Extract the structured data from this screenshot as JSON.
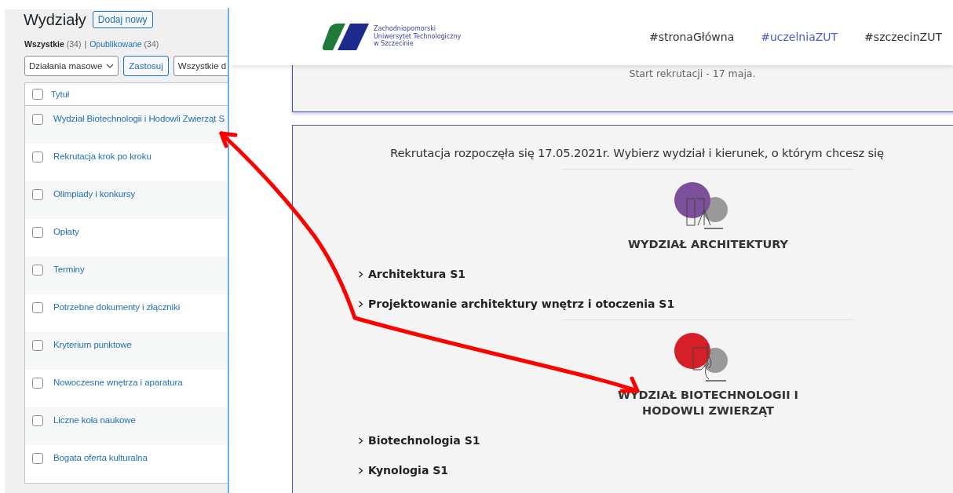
{
  "admin": {
    "title": "Wydziały",
    "add_button": "Dodaj nowy",
    "filters": [
      {
        "label": "Wszystkie",
        "count": "(34)",
        "selected": true
      },
      {
        "label": "Opublikowane",
        "count": "(34)",
        "selected": false
      }
    ],
    "filter_separator": "|",
    "bulk_actions": "Działania masowe",
    "apply_button": "Zastosuj",
    "date_filter": "Wszystkie d",
    "table": {
      "column": "Tytuł",
      "header_checked": false,
      "rows": [
        {
          "title": "Wydział Biotechnologii i Hodowli Zwierząt S",
          "checked": false
        },
        {
          "title": "Rekrutacja krok po kroku",
          "checked": false
        },
        {
          "title": "Olimpiady i konkursy",
          "checked": false
        },
        {
          "title": "Opłaty",
          "checked": false
        },
        {
          "title": "Terminy",
          "checked": false
        },
        {
          "title": "Potrzebne dokumenty i złączniki",
          "checked": false
        },
        {
          "title": "Kryterium punktowe",
          "checked": false
        },
        {
          "title": "Nowoczesne wnętrza i aparatura",
          "checked": false
        },
        {
          "title": "Liczne koła naukowe",
          "checked": false
        },
        {
          "title": "Bogata oferta kulturalna",
          "checked": false
        }
      ]
    }
  },
  "site": {
    "logo_lines": [
      "Zachodniopomorski",
      "Uniwersytet Technologiczny",
      "w Szczecinie"
    ],
    "nav": [
      {
        "label": "#stronaGłówna",
        "selected": false
      },
      {
        "label": "#uczelniaZUT",
        "selected": true
      },
      {
        "label": "#szczecinZUT",
        "selected": false
      }
    ],
    "notice": "Start rekrutacji - 17 maja.",
    "intro": "Rekrutacja rozpoczęła się 17.05.2021r. Wybierz wydział i kierunek, o którym chcesz się",
    "faculties": [
      {
        "name": "WYDZIAŁ ARCHITEKTURY",
        "color": "#7b4f9a",
        "programs": [
          "Architektura S1",
          "Projektowanie architektury wnętrz i otoczenia S1"
        ]
      },
      {
        "name": "WYDZIAŁ BIOTECHNOLOGII I HODOWLI ZWIERZĄT",
        "color": "#d52029",
        "programs": [
          "Biotechnologia S1",
          "Kynologia S1"
        ]
      }
    ]
  }
}
